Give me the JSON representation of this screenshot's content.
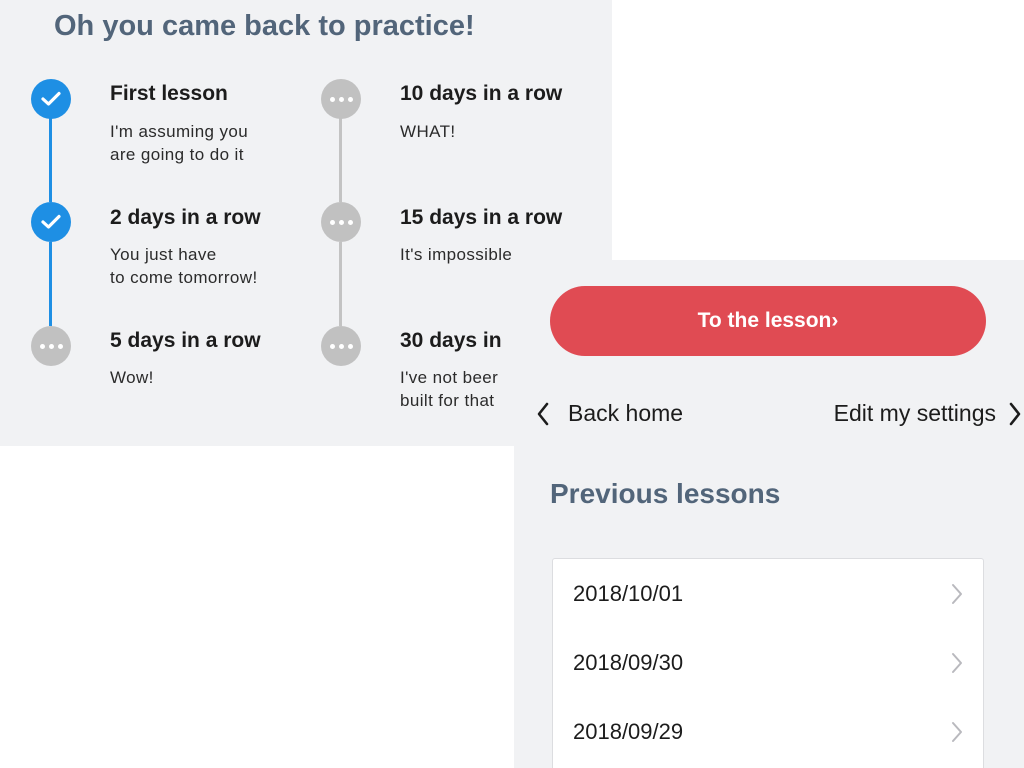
{
  "streak": {
    "title": "Oh you came back to practice!",
    "milestones_left": [
      {
        "title": "First lesson",
        "description": "I'm assuming you\nare going to do it",
        "status": "done"
      },
      {
        "title": "2 days in a row",
        "description": "You just have\nto come tomorrow!",
        "status": "done"
      },
      {
        "title": "5 days in a row",
        "description": "Wow!",
        "status": "pending"
      }
    ],
    "milestones_right": [
      {
        "title": "10 days in a row",
        "description": "WHAT!",
        "status": "pending"
      },
      {
        "title": "15 days in a row",
        "description": "It's impossible",
        "status": "pending"
      },
      {
        "title": "30 days in",
        "description": "I've not beer\nbuilt for that",
        "status": "pending"
      }
    ]
  },
  "lessons": {
    "cta_label": "To the lesson›",
    "back_label": "Back home",
    "settings_label": "Edit my settings",
    "previous_title": "Previous lessons",
    "previous": [
      {
        "date": "2018/10/01"
      },
      {
        "date": "2018/09/30"
      },
      {
        "date": "2018/09/29"
      }
    ]
  },
  "colors": {
    "accent_blue": "#1e8fe4",
    "pending_gray": "#c1c1c1",
    "cta_red": "#e04b53",
    "heading_slate": "#52657a",
    "panel_bg": "#f1f2f4"
  },
  "icons": {
    "done": "check-icon",
    "pending": "dots-icon",
    "back": "chevron-left-icon",
    "forward": "chevron-right-icon"
  }
}
